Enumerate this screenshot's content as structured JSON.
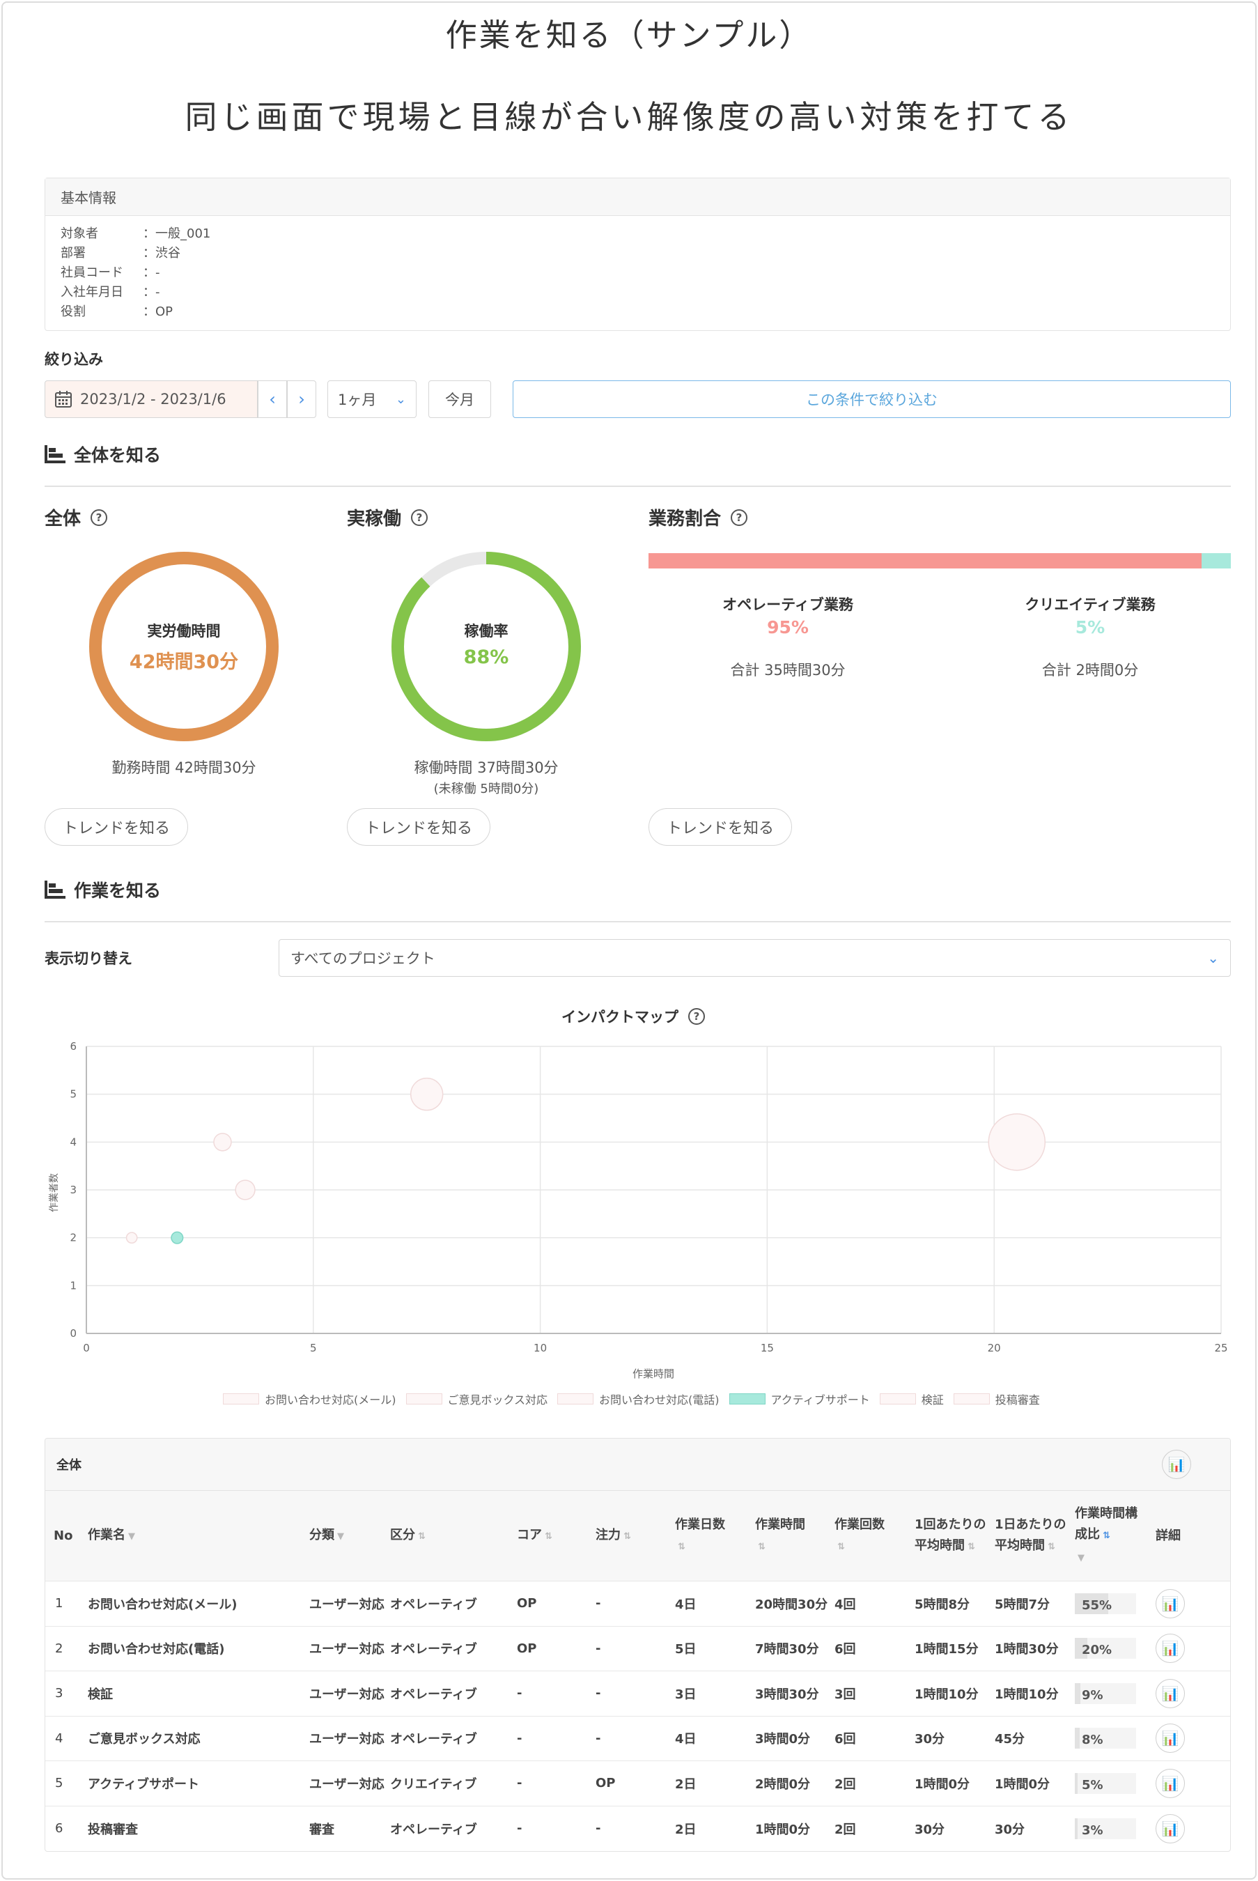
{
  "page": {
    "title": "作業を知る（サンプル）",
    "subtitle": "同じ画面で現場と目線が合い解像度の高い対策を打てる"
  },
  "basic_info": {
    "header": "基本情報",
    "rows": [
      {
        "key": "対象者",
        "value": "：一般_001"
      },
      {
        "key": "部署",
        "value": "：渋谷"
      },
      {
        "key": "社員コード",
        "value": "：-"
      },
      {
        "key": "入社年月日",
        "value": "：-"
      },
      {
        "key": "役割",
        "value": "：OP"
      }
    ]
  },
  "filter": {
    "label": "絞り込み",
    "date_range": "2023/1/2 - 2023/1/6",
    "period": "1ヶ月",
    "today": "今月",
    "apply": "この条件で絞り込む"
  },
  "overview": {
    "title": "全体を知る",
    "total": {
      "title": "全体",
      "center_label": "実労働時間",
      "center_value": "42時間30分",
      "sub": "勤務時間 42時間30分",
      "fill": 1.0,
      "color": "#df9150"
    },
    "active": {
      "title": "実稼働",
      "center_label": "稼働率",
      "center_value": "88%",
      "sub": "稼働時間 37時間30分",
      "sub2": "(未稼働 5時間0分)",
      "fill": 0.88,
      "color": "#84c44a"
    },
    "ratio": {
      "title": "業務割合",
      "operative": {
        "label": "オペレーティブ業務",
        "pct": "95%",
        "total": "合計 35時間30分",
        "value": 0.95,
        "color": "#f79792"
      },
      "creative": {
        "label": "クリエイティブ業務",
        "pct": "5%",
        "total": "合計 2時間0分",
        "value": 0.05,
        "color": "#a7e9dc"
      }
    },
    "trend": "トレンドを知る"
  },
  "work": {
    "title": "作業を知る",
    "switch_label": "表示切り替え",
    "switch_value": "すべてのプロジェクト"
  },
  "chart_data": {
    "type": "scatter",
    "title": "インパクトマップ",
    "xlabel": "作業時間",
    "ylabel": "作業者数",
    "xlim": [
      0,
      25
    ],
    "ylim": [
      0,
      6
    ],
    "xticks": [
      "0",
      "5",
      "10",
      "15",
      "20",
      "25"
    ],
    "yticks": [
      "0",
      "1",
      "2",
      "3",
      "4",
      "5",
      "6"
    ],
    "grid": true,
    "legend_position": "bottom",
    "series": [
      {
        "name": "お問い合わせ対応(メール)",
        "x": 20.5,
        "y": 4,
        "size": 55
      },
      {
        "name": "ご意見ボックス対応",
        "x": 1.0,
        "y": 2,
        "size": 8
      },
      {
        "name": "お問い合わせ対応(電話)",
        "x": 7.5,
        "y": 5,
        "size": 30
      },
      {
        "name": "アクティブサポート",
        "x": 2.0,
        "y": 2,
        "size": 9
      },
      {
        "name": "検証",
        "x": 3.5,
        "y": 3,
        "size": 17
      },
      {
        "name": "投稿審査",
        "x": 3.0,
        "y": 4,
        "size": 15
      }
    ]
  },
  "table": {
    "title": "全体",
    "headers": {
      "no": "No",
      "name": "作業名",
      "category": "分類",
      "division": "区分",
      "core": "コア",
      "focus": "注力",
      "days": "作業日数",
      "time": "作業時間",
      "count": "作業回数",
      "avg_per": "1回あたりの平均時間",
      "avg_day": "1日あたりの平均時間",
      "ratio": "作業時間構成比",
      "detail": "詳細"
    },
    "rows": [
      {
        "no": "1",
        "name": "お問い合わせ対応(メール)",
        "category": "ユーザー対応",
        "division": "オペレーティブ",
        "core": "OP",
        "focus": "-",
        "days": "4日",
        "time": "20時間30分",
        "count": "4回",
        "avg_per": "5時間8分",
        "avg_day": "5時間7分",
        "ratio": "55%",
        "ratio_value": 0.55
      },
      {
        "no": "2",
        "name": "お問い合わせ対応(電話)",
        "category": "ユーザー対応",
        "division": "オペレーティブ",
        "core": "OP",
        "focus": "-",
        "days": "5日",
        "time": "7時間30分",
        "count": "6回",
        "avg_per": "1時間15分",
        "avg_day": "1時間30分",
        "ratio": "20%",
        "ratio_value": 0.2
      },
      {
        "no": "3",
        "name": "検証",
        "category": "ユーザー対応",
        "division": "オペレーティブ",
        "core": "-",
        "focus": "-",
        "days": "3日",
        "time": "3時間30分",
        "count": "3回",
        "avg_per": "1時間10分",
        "avg_day": "1時間10分",
        "ratio": "9%",
        "ratio_value": 0.09
      },
      {
        "no": "4",
        "name": "ご意見ボックス対応",
        "category": "ユーザー対応",
        "division": "オペレーティブ",
        "core": "-",
        "focus": "-",
        "days": "4日",
        "time": "3時間0分",
        "count": "6回",
        "avg_per": "30分",
        "avg_day": "45分",
        "ratio": "8%",
        "ratio_value": 0.08
      },
      {
        "no": "5",
        "name": "アクティブサポート",
        "category": "ユーザー対応",
        "division": "クリエイティブ",
        "core": "-",
        "focus": "OP",
        "days": "2日",
        "time": "2時間0分",
        "count": "2回",
        "avg_per": "1時間0分",
        "avg_day": "1時間0分",
        "ratio": "5%",
        "ratio_value": 0.05
      },
      {
        "no": "6",
        "name": "投稿審査",
        "category": "審査",
        "division": "オペレーティブ",
        "core": "-",
        "focus": "-",
        "days": "2日",
        "time": "1時間0分",
        "count": "2回",
        "avg_per": "30分",
        "avg_day": "30分",
        "ratio": "3%",
        "ratio_value": 0.03
      }
    ]
  }
}
